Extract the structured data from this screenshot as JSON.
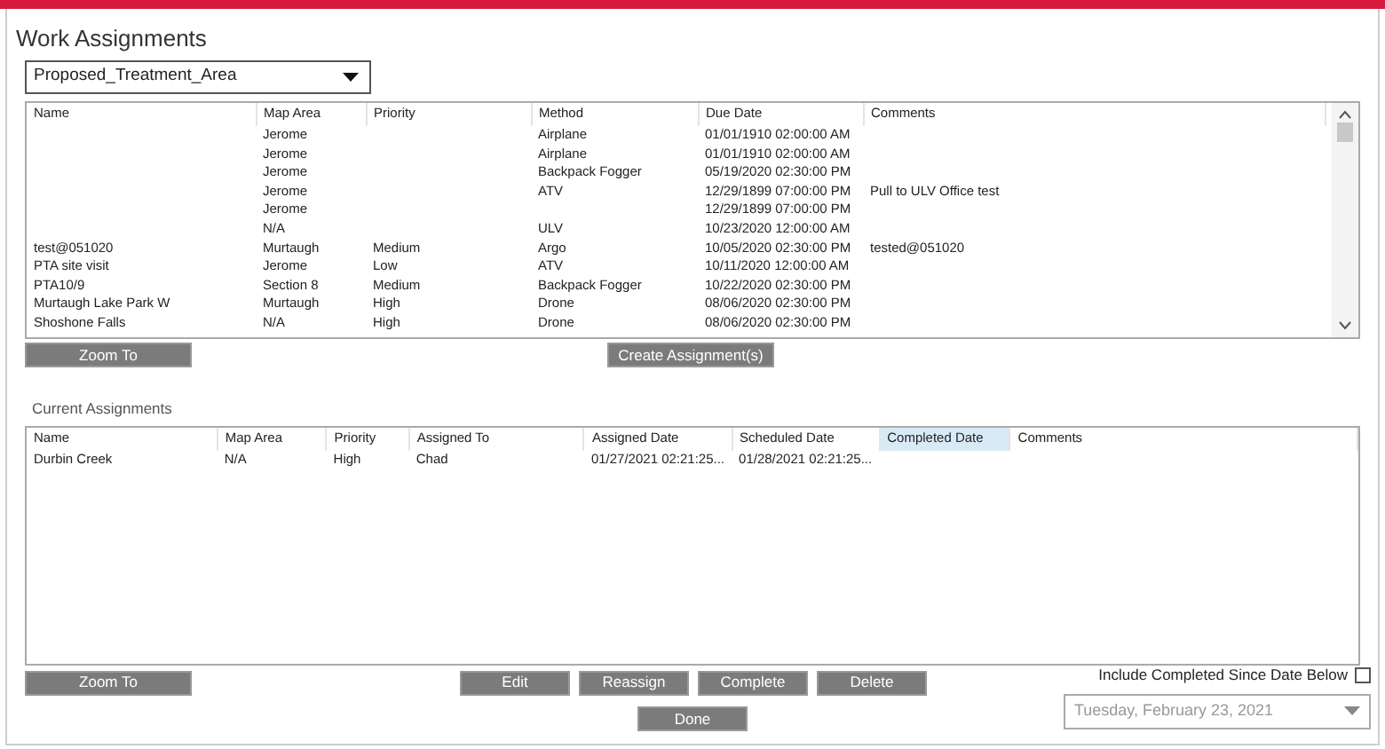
{
  "title": "Work Assignments",
  "layer_select": {
    "value": "Proposed_Treatment_Area"
  },
  "proposed_table": {
    "columns": [
      {
        "label": "Name"
      },
      {
        "label": "Map Area"
      },
      {
        "label": "Priority"
      },
      {
        "label": "Method"
      },
      {
        "label": "Due Date"
      },
      {
        "label": "Comments"
      }
    ],
    "rows": [
      [
        "",
        "Jerome",
        "",
        "Airplane",
        "01/01/1910 02:00:00 AM",
        ""
      ],
      [
        "",
        "Jerome",
        "",
        "Airplane",
        "01/01/1910 02:00:00 AM",
        ""
      ],
      [
        "",
        "Jerome",
        "",
        "Backpack Fogger",
        "05/19/2020 02:30:00 PM",
        ""
      ],
      [
        "",
        "Jerome",
        "",
        "ATV",
        "12/29/1899 07:00:00 PM",
        "Pull to ULV Office test"
      ],
      [
        "",
        "Jerome",
        "",
        "",
        "12/29/1899 07:00:00 PM",
        ""
      ],
      [
        "",
        "N/A",
        "",
        "ULV",
        "10/23/2020 12:00:00 AM",
        ""
      ],
      [
        "test@051020",
        "Murtaugh",
        "Medium",
        "Argo",
        "10/05/2020 02:30:00 PM",
        "tested@051020"
      ],
      [
        "PTA site visit",
        "Jerome",
        "Low",
        "ATV",
        "10/11/2020 12:00:00 AM",
        ""
      ],
      [
        "PTA10/9",
        "Section 8",
        "Medium",
        "Backpack Fogger",
        "10/22/2020 02:30:00 PM",
        ""
      ],
      [
        "Murtaugh Lake Park W",
        "Murtaugh",
        "High",
        "Drone",
        "08/06/2020 02:30:00 PM",
        ""
      ],
      [
        "Shoshone Falls",
        "N/A",
        "High",
        "Drone",
        "08/06/2020 02:30:00 PM",
        ""
      ]
    ]
  },
  "proposed_buttons": [
    "Zoom To",
    "Create Assignment(s)"
  ],
  "current_label": "Current Assignments",
  "current_table": {
    "columns": [
      {
        "label": "Name",
        "highlighted": false
      },
      {
        "label": "Map Area",
        "highlighted": false
      },
      {
        "label": "Priority",
        "highlighted": false
      },
      {
        "label": "Assigned To",
        "highlighted": false
      },
      {
        "label": "Assigned Date",
        "highlighted": false
      },
      {
        "label": "Scheduled Date",
        "highlighted": false
      },
      {
        "label": "Completed Date",
        "highlighted": true
      },
      {
        "label": "Comments",
        "highlighted": false
      }
    ],
    "rows": [
      [
        "Durbin Creek",
        "N/A",
        "High",
        "Chad",
        "01/27/2021 02:21:25...",
        "01/28/2021 02:21:25...",
        "",
        ""
      ]
    ]
  },
  "current_buttons": [
    "Zoom To",
    "Edit",
    "Reassign",
    "Complete",
    "Delete"
  ],
  "include_completed": {
    "label": "Include Completed Since Date Below",
    "checked": false
  },
  "date_picker": {
    "value": "Tuesday, February 23, 2021",
    "disabled": true
  },
  "done_button": "Done"
}
